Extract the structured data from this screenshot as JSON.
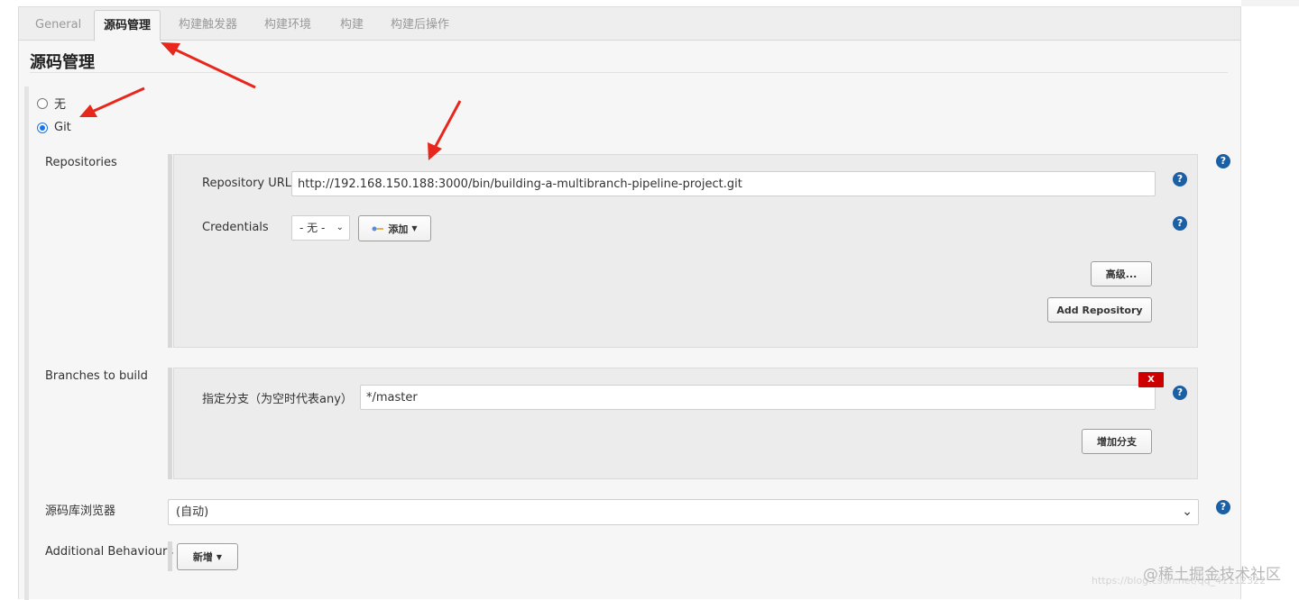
{
  "tabs": [
    {
      "label": "General"
    },
    {
      "label": "源码管理"
    },
    {
      "label": "构建触发器"
    },
    {
      "label": "构建环境"
    },
    {
      "label": "构建"
    },
    {
      "label": "构建后操作"
    }
  ],
  "section_title": "源码管理",
  "scm_options": [
    {
      "label": "无",
      "checked": false
    },
    {
      "label": "Git",
      "checked": true
    }
  ],
  "repositories": {
    "label": "Repositories",
    "url_label": "Repository URL",
    "url_value": "http://192.168.150.188:3000/bin/building-a-multibranch-pipeline-project.git",
    "credentials_label": "Credentials",
    "credentials_value": "- 无 -",
    "add_label": "添加",
    "advanced_label": "高级...",
    "add_repository_label": "Add Repository"
  },
  "branches": {
    "label": "Branches to build",
    "branch_label": "指定分支（为空时代表any）",
    "branch_value": "*/master",
    "delete_label": "X",
    "add_branch_label": "增加分支"
  },
  "browser": {
    "label": "源码库浏览器",
    "value": "(自动)"
  },
  "behaviours": {
    "label": "Additional Behaviours",
    "add_label": "新增"
  },
  "help_glyph": "?",
  "watermark": "@稀土掘金技术社区",
  "url_watermark": "https://blog.csdn.net/qq_41112322",
  "colors": {
    "help": "#1b5fa5",
    "delete": "#cc0000",
    "arrow": "#e8261c",
    "radio_checked": "#1a73e8"
  },
  "icons": {
    "credentials_add": "key-icon",
    "dropdown": "caret-down-icon",
    "help": "help-icon"
  }
}
